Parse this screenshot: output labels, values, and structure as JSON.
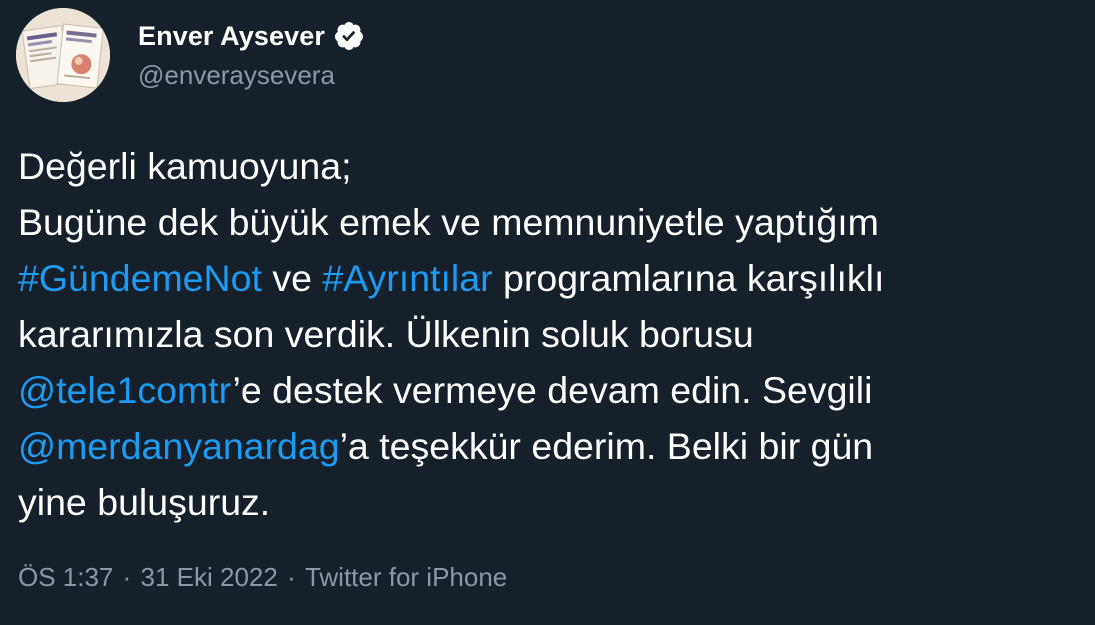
{
  "author": {
    "display_name": "Enver Aysever",
    "handle": "@enveraysevera",
    "verified_icon": "verified-badge-icon"
  },
  "tweet": {
    "line1": "Değerli kamuoyuna;",
    "line2": "Bugüne dek büyük emek ve memnuniyetle yaptığım",
    "hashtag1": "#GündemeNot",
    "word_ve": " ve ",
    "hashtag2": "#Ayrıntılar",
    "line3_rest": " programlarına karşılıklı",
    "line4": "kararımızla son verdik. Ülkenin soluk borusu",
    "mention1": "@tele1comtr",
    "line5_rest": "’e destek vermeye devam edin. Sevgili",
    "mention2": "@merdanyanardag",
    "line6_rest": "’a teşekkür ederim. Belki bir gün",
    "line7": "yine buluşuruz."
  },
  "meta": {
    "time": "ÖS 1:37",
    "separator": " · ",
    "date": "31 Eki 2022",
    "source": "Twitter for iPhone"
  },
  "colors": {
    "background": "#15202b",
    "text": "#ffffff",
    "secondary": "#8b98a5",
    "link": "#1d9bf0"
  }
}
